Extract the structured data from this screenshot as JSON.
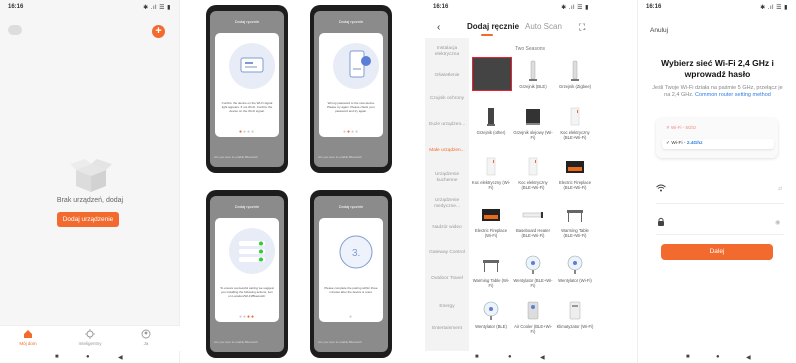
{
  "screen1": {
    "time": "16:16",
    "status_icons": "✱ .ıl ☰ ▮",
    "empty_text": "Brak urządzeń, dodaj",
    "add_device_label": "Dodaj urządzenie",
    "tabs": [
      {
        "label": "Mój dom",
        "icon": "home-icon",
        "active": true
      },
      {
        "label": "Inteligentny",
        "icon": "scene-icon",
        "active": false
      },
      {
        "label": "Ja",
        "icon": "profile-icon",
        "active": false
      }
    ]
  },
  "phones": [
    {
      "header": "Dodaj ręcznie",
      "text": "Confirm the device on the Wi-Fi signal light appears. If not Wi-Fi. Confirm the device on the Wi-Fi signal.",
      "foot": "Are you sure to enable Bluetooth"
    },
    {
      "header": "Dodaj ręcznie",
      "text": "Wrong password to the new device Please try again. Please check your password and try again.",
      "foot": "Are you sure to enable Bluetooth"
    },
    {
      "header": "Dodaj ręcznie",
      "text": "To ensure successful pairing we suggest you installing the following actions; turn on Location/Wi-Fi/Bluetooth.",
      "foot": "Are you sure to enable Bluetooth"
    },
    {
      "header": "Dodaj ręcznie",
      "text": "Please complete the pairing within three minutes after the device is reset.",
      "foot": "Are you sure to enable Bluetooth"
    }
  ],
  "screen3": {
    "time": "16:16",
    "status_icons": "✱ .ıl ☰ ▮",
    "tab_manual": "Dodaj ręcznie",
    "tab_auto": "Auto Scan",
    "section": "Two Seasons",
    "categories": [
      "Instalacja elektryczna",
      "Oświetlenie",
      "Czujnik ochrony",
      "Duże urządzen...",
      "Małe urządzen...",
      "Urządzenie kuchenne",
      "Urządzenie medyczne...",
      "Nadzór wideo",
      "Gateway Control",
      "Outdoor Travel",
      "Energy",
      "Entertainment"
    ],
    "active_category": 4,
    "devices": [
      {
        "label": "",
        "icon": "selected-device"
      },
      {
        "label": "Grzejnik (BLE)",
        "icon": "tower-heater-icon"
      },
      {
        "label": "Grzejnik (Zigbee)",
        "icon": "tower-heater-icon"
      },
      {
        "label": "Grzejnik (other)",
        "icon": "panel-heater-icon"
      },
      {
        "label": "Grzejnik olejowy (Wi-Fi)",
        "icon": "oil-heater-icon"
      },
      {
        "label": "Koc elektryczny (BLE+Wi-Fi)",
        "icon": "blanket-icon"
      },
      {
        "label": "Koc elektryczny (Wi-Fi)",
        "icon": "blanket-icon"
      },
      {
        "label": "Koc elektryczny (BLE+Wi-Fi)",
        "icon": "blanket-icon"
      },
      {
        "label": "Electric Fireplace (BLE+Wi-Fi)",
        "icon": "fireplace-icon"
      },
      {
        "label": "Electric Fireplace (Wi-Fi)",
        "icon": "fireplace-icon"
      },
      {
        "label": "Baseboard Heater (BLE+Wi-Fi)",
        "icon": "baseboard-icon"
      },
      {
        "label": "Warming Table (BLE+Wi-Fi)",
        "icon": "table-icon"
      },
      {
        "label": "Warming Table (Wi-Fi)",
        "icon": "table-icon"
      },
      {
        "label": "Wentylator (BLE+Wi-Fi)",
        "icon": "fan-icon"
      },
      {
        "label": "Wentylator (Wi-Fi)",
        "icon": "fan-icon"
      },
      {
        "label": "Wentylator (BLE)",
        "icon": "fan-icon"
      },
      {
        "label": "Air Cooler (BLE+Wi-Fi)",
        "icon": "cooler-icon"
      },
      {
        "label": "Klimatyzator (Wi-Fi)",
        "icon": "ac-icon"
      }
    ]
  },
  "screen4": {
    "time": "16:16",
    "status_icons": "✱ .ıl ☰ ▮",
    "cancel": "Anuluj",
    "title": "Wybierz sieć Wi-Fi 2,4 GHz i wprowadź hasło",
    "desc": "Jeśli Twoje Wi-Fi działa na paśmie 5 GHz, przełącz je na 2,4 GHz.",
    "desc_link": "Common router setting method",
    "wifi_5g": "✕ Wi-Fi - 5Ghz",
    "wifi_24g_prefix": "✓  Wi-Fi - ",
    "wifi_24g": "2.4Ghz",
    "next": "Dalej"
  }
}
